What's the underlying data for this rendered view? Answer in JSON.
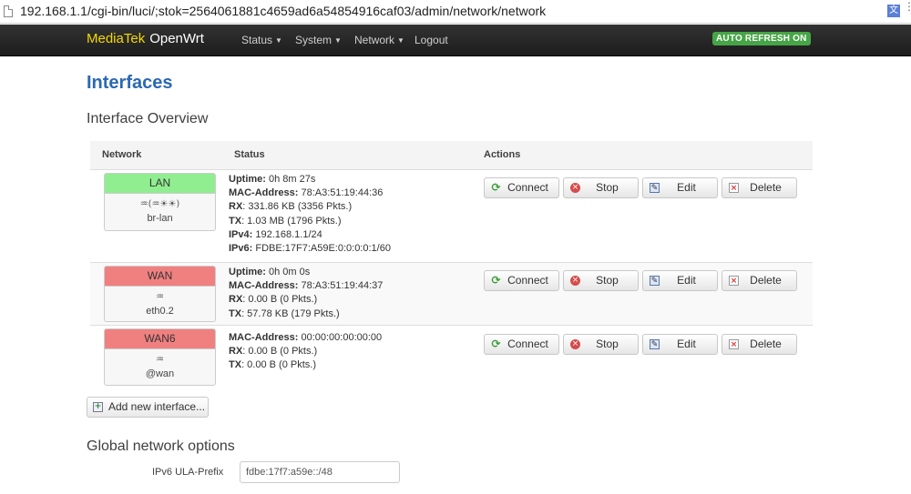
{
  "browser": {
    "url": "192.168.1.1/cgi-bin/luci/;stok=2564061881c4659ad6a54854916caf03/admin/network/network"
  },
  "navbar": {
    "brand_primary": "MediaTek",
    "brand_secondary": "OpenWrt",
    "menu": [
      {
        "label": "Status",
        "has_dropdown": true
      },
      {
        "label": "System",
        "has_dropdown": true
      },
      {
        "label": "Network",
        "has_dropdown": true
      },
      {
        "label": "Logout",
        "has_dropdown": false
      }
    ],
    "auto_refresh": "AUTO REFRESH ON"
  },
  "page": {
    "title": "Interfaces",
    "section_title": "Interface Overview"
  },
  "table": {
    "headers": {
      "network": "Network",
      "status": "Status",
      "actions": "Actions"
    },
    "action_labels": {
      "connect": "Connect",
      "stop": "Stop",
      "edit": "Edit",
      "delete": "Delete"
    },
    "rows": [
      {
        "name": "LAN",
        "header_color": "#90ee90",
        "icons": "♒(♒☀☀)",
        "device": "br-lan",
        "status": [
          {
            "key": "Uptime:",
            "value": " 0h 8m 27s"
          },
          {
            "key": "MAC-Address:",
            "value": " 78:A3:51:19:44:36"
          },
          {
            "key": "RX",
            "value": ": 331.86 KB (3356 Pkts.)"
          },
          {
            "key": "TX",
            "value": ": 1.03 MB (1796 Pkts.)"
          },
          {
            "key": "IPv4:",
            "value": " 192.168.1.1/24"
          },
          {
            "key": "IPv6:",
            "value": " FDBE:17F7:A59E:0:0:0:0:1/60"
          }
        ]
      },
      {
        "name": "WAN",
        "header_color": "#f08080",
        "icons": "♒",
        "device": "eth0.2",
        "status": [
          {
            "key": "Uptime:",
            "value": " 0h 0m 0s"
          },
          {
            "key": "MAC-Address:",
            "value": " 78:A3:51:19:44:37"
          },
          {
            "key": "RX",
            "value": ": 0.00 B (0 Pkts.)"
          },
          {
            "key": "TX",
            "value": ": 57.78 KB (179 Pkts.)"
          }
        ]
      },
      {
        "name": "WAN6",
        "header_color": "#f08080",
        "icons": "♒",
        "device": "@wan",
        "status": [
          {
            "key": "MAC-Address:",
            "value": " 00:00:00:00:00:00"
          },
          {
            "key": "RX",
            "value": ": 0.00 B (0 Pkts.)"
          },
          {
            "key": "TX",
            "value": ": 0.00 B (0 Pkts.)"
          }
        ]
      }
    ]
  },
  "add_interface": {
    "label": "Add new interface..."
  },
  "global": {
    "title": "Global network options",
    "ula_label": "IPv6 ULA-Prefix",
    "ula_value": "fdbe:17f7:a59e::/48"
  },
  "colors": {
    "accent_heading": "#2b68b3",
    "brand_yellow": "#f5d800",
    "auto_refresh_green": "#46a546",
    "lan_green": "#90ee90",
    "wan_red": "#f08080"
  }
}
